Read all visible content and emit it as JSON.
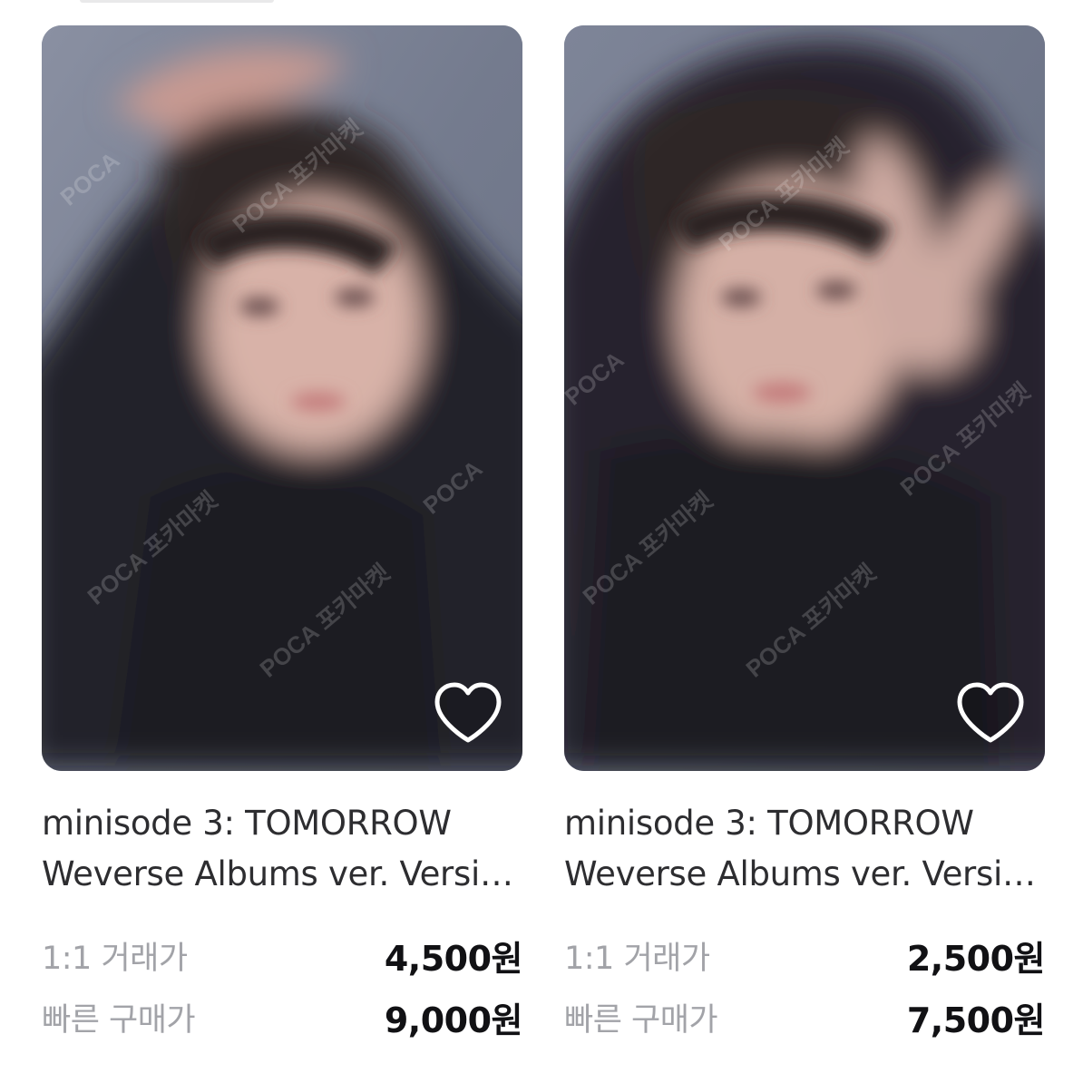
{
  "products": [
    {
      "title_line1": "minisode 3: TOMORROW",
      "title_line2": "Weverse Albums ver. Versio...",
      "prices": [
        {
          "label": "1:1 거래가",
          "value": "4,500원"
        },
        {
          "label": "빠른 구매가",
          "value": "9,000원"
        }
      ],
      "favorite_icon": "heart-outline-icon",
      "watermark": "POCA 포카마켓"
    },
    {
      "title_line1": "minisode 3: TOMORROW",
      "title_line2": "Weverse Albums ver. Versio...",
      "prices": [
        {
          "label": "1:1 거래가",
          "value": "2,500원"
        },
        {
          "label": "빠른 구매가",
          "value": "7,500원"
        }
      ],
      "favorite_icon": "heart-outline-icon",
      "watermark": "POCA 포카마켓"
    }
  ]
}
